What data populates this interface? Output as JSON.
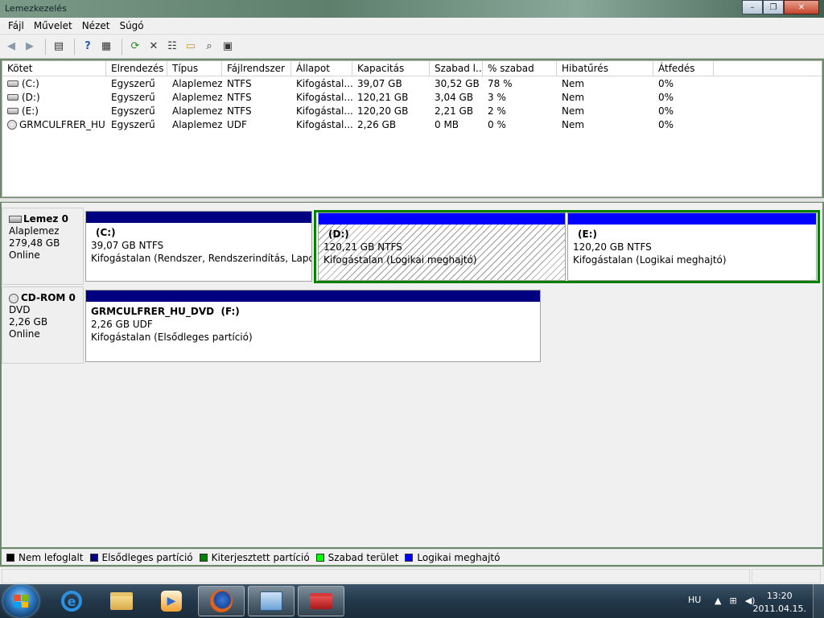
{
  "window": {
    "title": "Lemezkezelés",
    "minimize_label": "–",
    "maximize_label": "❐",
    "close_label": "✕"
  },
  "menu": [
    "Fájl",
    "Művelet",
    "Nézet",
    "Súgó"
  ],
  "toolbar_icons": [
    "back-icon",
    "forward-icon",
    "console-tree-icon",
    "help-icon",
    "help-topics-icon",
    "refresh-icon",
    "delete-icon",
    "properties-icon",
    "open-icon",
    "explore-icon",
    "rescan-disks-icon"
  ],
  "volume_list": {
    "columns": [
      "Kötet",
      "Elrendezés",
      "Típus",
      "Fájlrendszer",
      "Állapot",
      "Kapacitás",
      "Szabad l...",
      "% szabad",
      "Hibatűrés",
      "Átfedés"
    ],
    "rows": [
      {
        "icon": "drive-icon",
        "cells": [
          "(C:)",
          "Egyszerű",
          "Alaplemez",
          "NTFS",
          "Kifogástal...",
          "39,07 GB",
          "30,52 GB",
          "78 %",
          "Nem",
          "0%"
        ]
      },
      {
        "icon": "drive-icon",
        "cells": [
          "(D:)",
          "Egyszerű",
          "Alaplemez",
          "NTFS",
          "Kifogástal...",
          "120,21 GB",
          "3,04 GB",
          "3 %",
          "Nem",
          "0%"
        ]
      },
      {
        "icon": "drive-icon",
        "cells": [
          "(E:)",
          "Egyszerű",
          "Alaplemez",
          "NTFS",
          "Kifogástal...",
          "120,20 GB",
          "2,21 GB",
          "2 %",
          "Nem",
          "0%"
        ]
      },
      {
        "icon": "cd-icon",
        "cells": [
          "GRMCULFRER_HU...",
          "Egyszerű",
          "Alaplemez",
          "UDF",
          "Kifogástal...",
          "2,26 GB",
          "0 MB",
          "0 %",
          "Nem",
          "0%"
        ]
      }
    ]
  },
  "disks": [
    {
      "name": "Lemez 0",
      "type": "Alaplemez",
      "size": "279,48 GB",
      "status": "Online",
      "partitions": [
        {
          "name": "(C:)",
          "size_fs": "39,07 GB NTFS",
          "status": "Kifogástalan (Rendszer, Rendszerindítás, Lapozófájl, Aktív, Összeomlási memóriakép, Elsődleges partíció)",
          "bar_color": "#000080"
        },
        {
          "name": "(D:)",
          "size_fs": "120,21 GB NTFS",
          "status": "Kifogástalan (Logikai meghajtó)",
          "bar_color": "#0000ff"
        },
        {
          "name": "(E:)",
          "size_fs": "120,20 GB NTFS",
          "status": "Kifogástalan (Logikai meghajtó)",
          "bar_color": "#0000ff"
        }
      ]
    },
    {
      "name": "CD-ROM 0",
      "type": "DVD",
      "size": "2,26 GB",
      "status": "Online",
      "partitions": [
        {
          "name": "GRMCULFRER_HU_DVD  (F:)",
          "size_fs": "2,26 GB UDF",
          "status": "Kifogástalan (Elsődleges partíció)",
          "bar_color": "#000080"
        }
      ]
    }
  ],
  "legend": [
    {
      "label": "Nem lefoglalt",
      "color": "#000000"
    },
    {
      "label": "Elsődleges partíció",
      "color": "#000080"
    },
    {
      "label": "Kiterjesztett partíció",
      "color": "#008000"
    },
    {
      "label": "Szabad terület",
      "color": "#00ff00"
    },
    {
      "label": "Logikai meghajtó",
      "color": "#0000ff"
    }
  ],
  "taskbar": {
    "apps": [
      "internet-explorer-icon",
      "explorer-folder-icon",
      "media-player-icon",
      "firefox-icon",
      "control-panel-icon",
      "computer-management-icon"
    ],
    "language": "HU",
    "time": "13:20",
    "date": "2011.04.15."
  }
}
